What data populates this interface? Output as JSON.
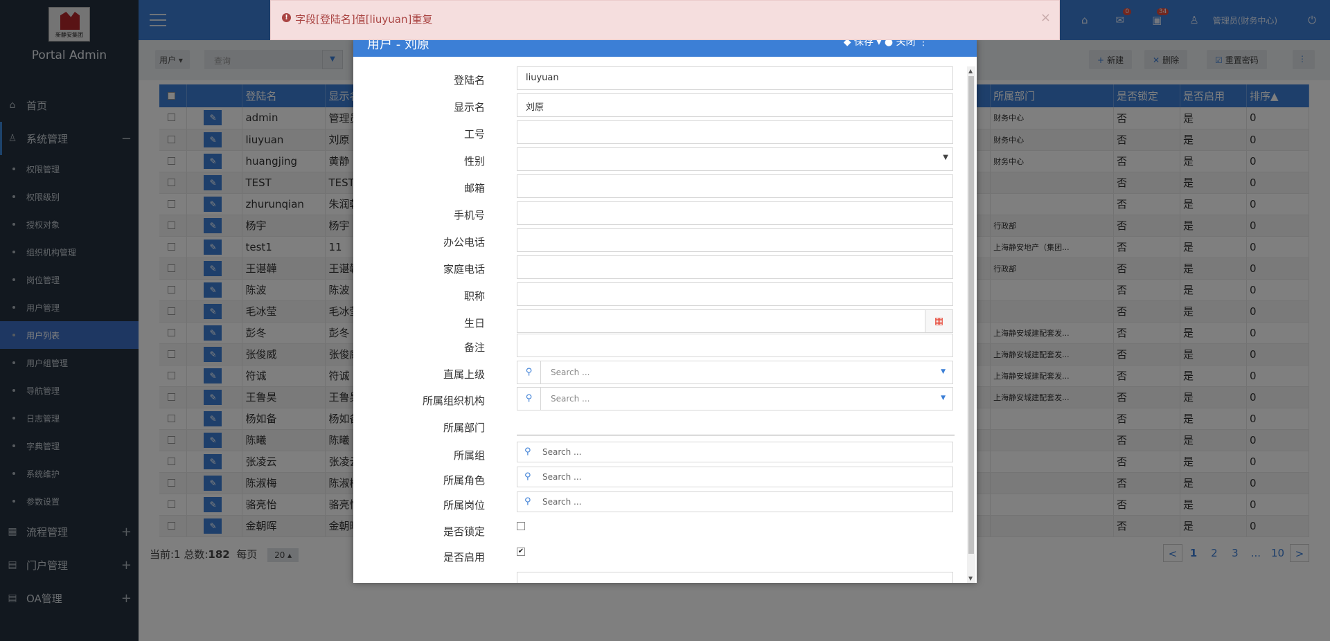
{
  "sidebar": {
    "logo_text": "新静安集团",
    "brand": "Portal Admin",
    "home": "首页",
    "system": "系统管理",
    "system_toggle": "−",
    "subs": [
      "权限管理",
      "权限级别",
      "授权对象",
      "组织机构管理",
      "岗位管理",
      "用户管理",
      "用户列表",
      "用户组管理",
      "导航管理",
      "日志管理",
      "字典管理",
      "系统维护",
      "参数设置"
    ],
    "process": "流程管理",
    "portal": "门户管理",
    "oa": "OA管理",
    "expand": "+"
  },
  "header": {
    "mail_count": "0",
    "task_count": "34",
    "user": "管理员(财务中心)"
  },
  "alert": {
    "text": "字段[登陆名]值[liuyuan]重复",
    "close": "×"
  },
  "toolbar": {
    "select": "用户",
    "search_placeholder": "查询",
    "new": "新建",
    "delete": "删除",
    "reset_pwd": "重置密码"
  },
  "table": {
    "headers": [
      "登陆名",
      "显示名",
      "所属部门",
      "是否锁定",
      "是否启用",
      "排序▲"
    ],
    "rows": [
      {
        "login": "admin",
        "name": "管理员",
        "dept": "财务中心",
        "lock": "否",
        "enable": "是",
        "order": "0"
      },
      {
        "login": "liuyuan",
        "name": "刘原",
        "dept": "财务中心",
        "lock": "否",
        "enable": "是",
        "order": "0"
      },
      {
        "login": "huangjing",
        "name": "黄静",
        "dept": "财务中心",
        "lock": "否",
        "enable": "是",
        "order": "0"
      },
      {
        "login": "TEST",
        "name": "TEST",
        "dept": "",
        "lock": "否",
        "enable": "是",
        "order": "0"
      },
      {
        "login": "zhurunqian",
        "name": "朱润乾",
        "dept": "",
        "lock": "否",
        "enable": "是",
        "order": "0"
      },
      {
        "login": "杨宇",
        "name": "杨宇",
        "dept": "行政部",
        "lock": "否",
        "enable": "是",
        "order": "0"
      },
      {
        "login": "test1",
        "name": "11",
        "dept": "上海静安地产（集团...",
        "lock": "否",
        "enable": "是",
        "order": "0"
      },
      {
        "login": "王谌韡",
        "name": "王谌韡",
        "dept": "行政部",
        "lock": "否",
        "enable": "是",
        "order": "0"
      },
      {
        "login": "陈波",
        "name": "陈波",
        "dept": "",
        "lock": "否",
        "enable": "是",
        "order": "0"
      },
      {
        "login": "毛冰莹",
        "name": "毛冰莹",
        "dept": "",
        "lock": "否",
        "enable": "是",
        "order": "0"
      },
      {
        "login": "彭冬",
        "name": "彭冬",
        "dept": "上海静安城建配套发...",
        "lock": "否",
        "enable": "是",
        "order": "0"
      },
      {
        "login": "张俊威",
        "name": "张俊威",
        "dept": "上海静安城建配套发...",
        "lock": "否",
        "enable": "是",
        "order": "0"
      },
      {
        "login": "符诚",
        "name": "符诚",
        "dept": "上海静安城建配套发...",
        "lock": "否",
        "enable": "是",
        "order": "0"
      },
      {
        "login": "王鲁昊",
        "name": "王鲁昊",
        "dept": "上海静安城建配套发...",
        "lock": "否",
        "enable": "是",
        "order": "0"
      },
      {
        "login": "杨如备",
        "name": "杨如备",
        "dept": "",
        "lock": "否",
        "enable": "是",
        "order": "0"
      },
      {
        "login": "陈曦",
        "name": "陈曦",
        "dept": "",
        "lock": "否",
        "enable": "是",
        "order": "0"
      },
      {
        "login": "张凌云",
        "name": "张凌云",
        "dept": "",
        "lock": "否",
        "enable": "是",
        "order": "0"
      },
      {
        "login": "陈淑梅",
        "name": "陈淑梅",
        "dept": "",
        "lock": "否",
        "enable": "是",
        "order": "0"
      },
      {
        "login": "骆亮怡",
        "name": "骆亮怡",
        "dept": "",
        "lock": "否",
        "enable": "是",
        "order": "0"
      },
      {
        "login": "金朝晖",
        "name": "金朝晖",
        "dept": "",
        "lock": "否",
        "enable": "是",
        "order": "0"
      }
    ]
  },
  "footer": {
    "current_label": "当前:1 总数:",
    "total": "182",
    "per_page_label": "每页",
    "page_size": "20 ▴",
    "pages": [
      "<",
      "1",
      "2",
      "3",
      "...",
      "10",
      ">"
    ]
  },
  "modal": {
    "title": "用户 - 刘原",
    "actions": "◆ 保存   ▾   ● 关闭   ⋮",
    "fields": {
      "login_label": "登陆名",
      "login_value": "liuyuan",
      "name_label": "显示名",
      "name_value": "刘原",
      "empno_label": "工号",
      "gender_label": "性别",
      "email_label": "邮箱",
      "mobile_label": "手机号",
      "office_phone_label": "办公电话",
      "home_phone_label": "家庭电话",
      "title_label": "职称",
      "birthday_label": "生日",
      "remark_label": "备注",
      "superior_label": "直属上级",
      "superior_placeholder": "Search ...",
      "org_label": "所属组织机构",
      "org_placeholder": "Search ...",
      "dept_label": "所属部门",
      "group_label": "所属组",
      "group_placeholder": "Search ...",
      "role_label": "所属角色",
      "role_placeholder": "Search ...",
      "post_label": "所属岗位",
      "post_placeholder": "Search ...",
      "locked_label": "是否锁定",
      "enabled_label": "是否启用"
    }
  }
}
